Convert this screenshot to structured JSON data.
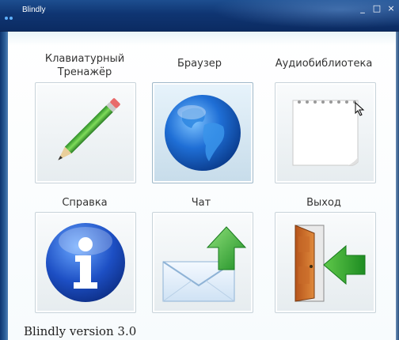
{
  "window": {
    "title": "Blindly",
    "minimize_glyph": "_",
    "maximize_glyph": "□",
    "close_glyph": "×"
  },
  "tiles": [
    {
      "label": "Клавиатурный Тренажёр",
      "icon": "pencil-icon"
    },
    {
      "label": "Браузер",
      "icon": "globe-icon"
    },
    {
      "label": "Аудиобиблиотека",
      "icon": "notepad-icon"
    },
    {
      "label": "Справка",
      "icon": "info-icon"
    },
    {
      "label": "Чат",
      "icon": "envelope-icon"
    },
    {
      "label": "Выход",
      "icon": "exit-door-icon"
    }
  ],
  "footer": {
    "version_text": "Blindly version 3.0"
  },
  "colors": {
    "titlebar": "#0f3572",
    "tile_border": "#c8d3da",
    "label_text": "#333333"
  }
}
